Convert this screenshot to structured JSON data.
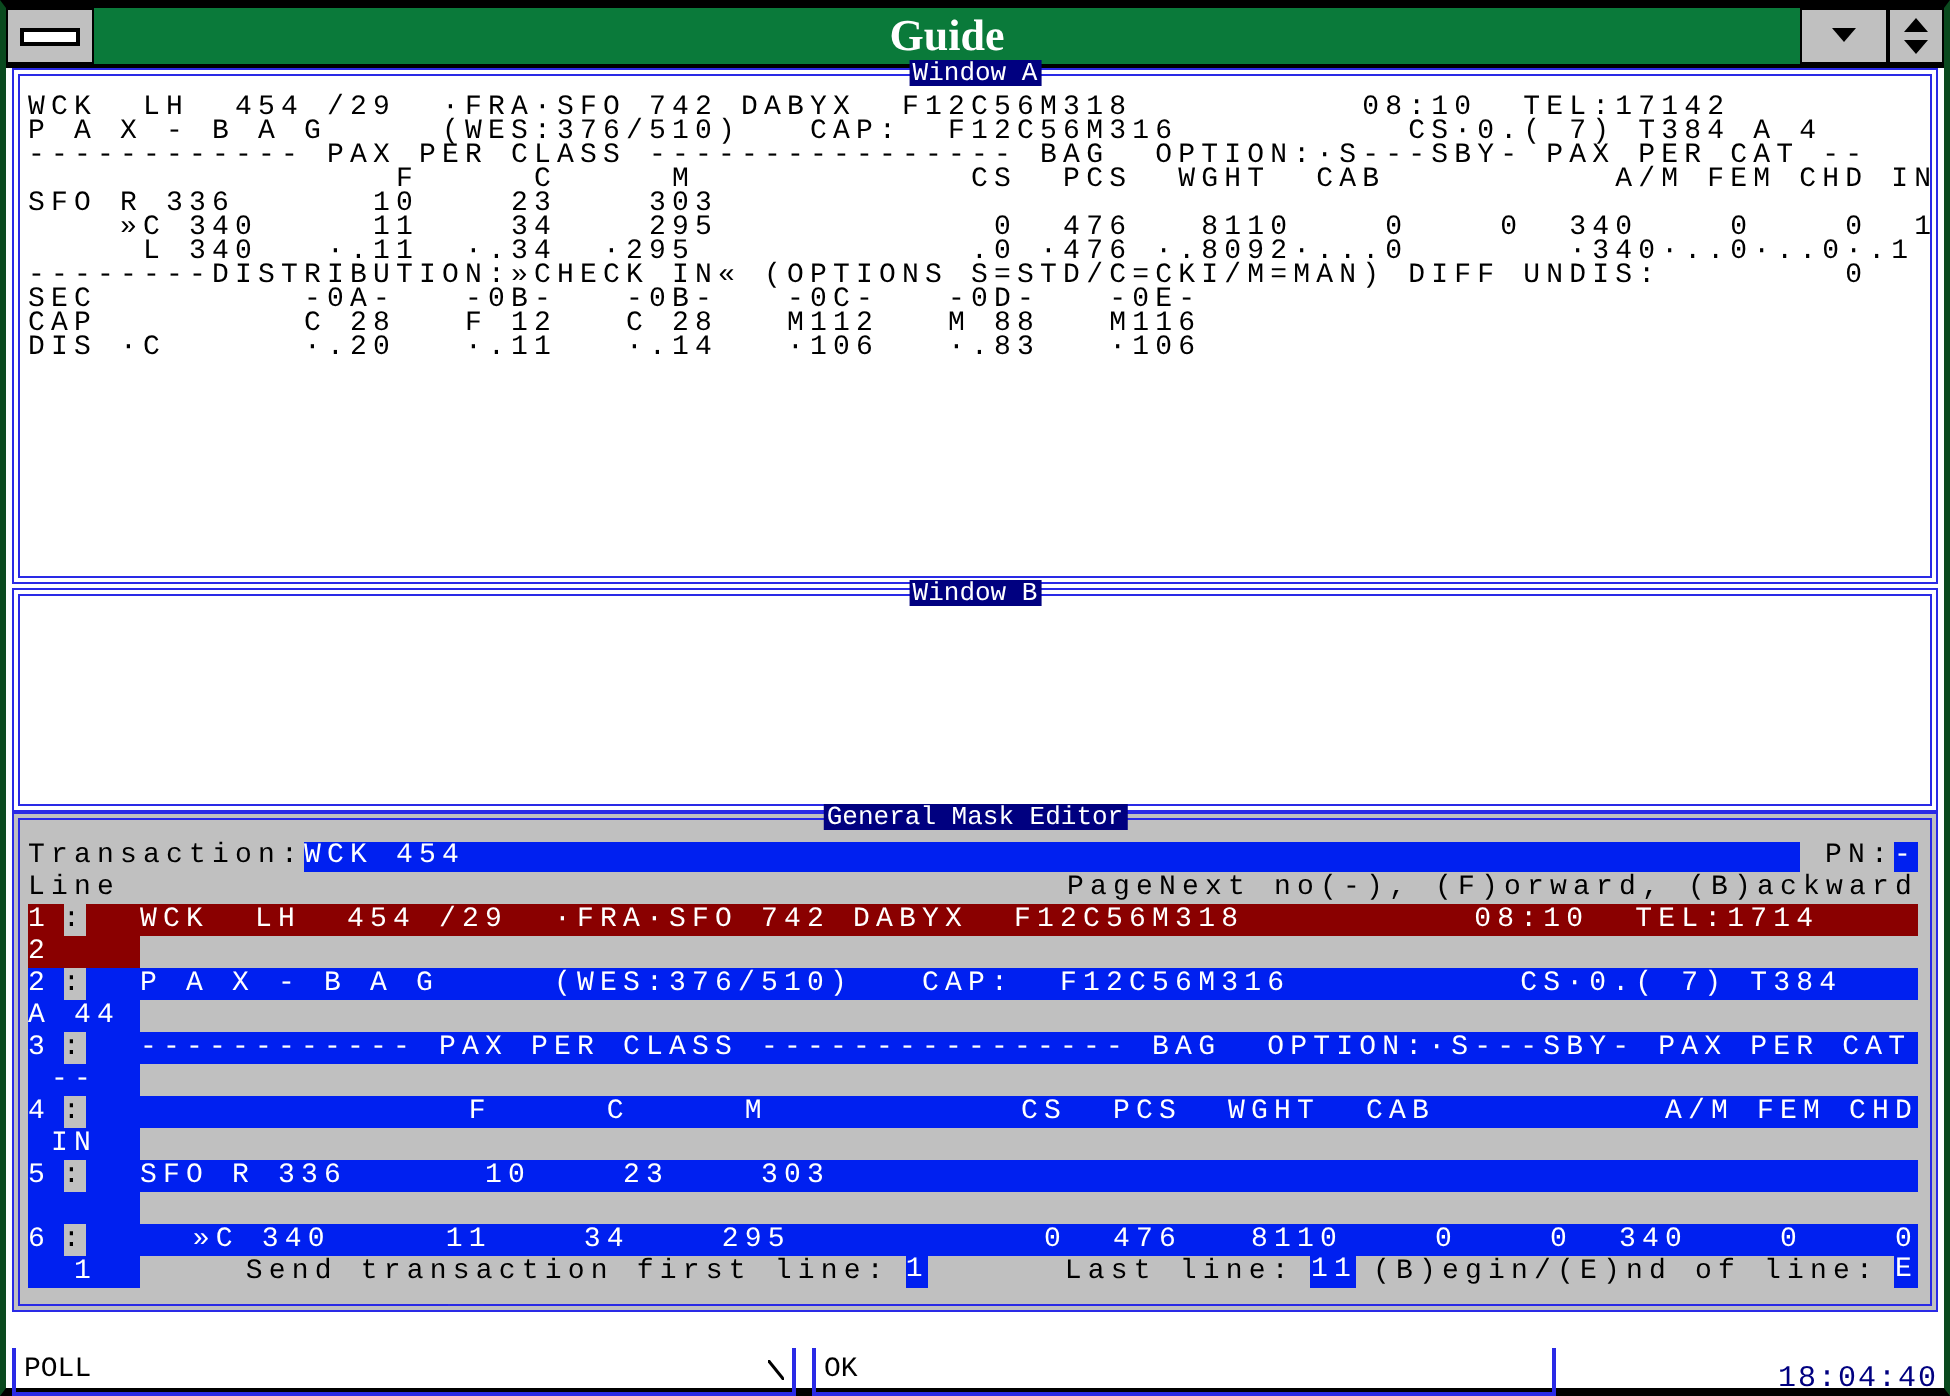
{
  "window": {
    "title": "Guide"
  },
  "window_a": {
    "title": "Window A",
    "lines": [
      "WCK  LH  454 /29  ·FRA·SFO 742 DABYX  F12C56M318          08:10  TEL:17142",
      "P A X - B A G     (WES:376/510)   CAP:  F12C56M316          CS·0.( 7) T384 A 4",
      "------------ PAX PER CLASS ---------------- BAG  OPTION:·S---SBY- PAX PER CAT --",
      "                F     C     M            CS  PCS  WGHT  CAB          A/M FEM CHD IN",
      "SFO R 336      10    23    303",
      "    »C 340     11    34    295            0  476   8110    0    0  340    0    0  1",
      "     L 340   ·.11  ·.34  ·295            .0 ·476 ·.8092·...0       ·340·..0·..0·.1",
      "--------DISTRIBUTION:»CHECK IN« (OPTIONS S=STD/C=CKI/M=MAN) DIFF UNDIS:        0",
      "SEC         -0A-   -0B-   -0B-   -0C-   -0D-   -0E-",
      "CAP         C 28   F 12   C 28   M112   M 88   M116",
      "DIS ·C      ·.20   ·.11   ·.14   ·106   ·.83   ·106"
    ]
  },
  "window_b": {
    "title": "Window B"
  },
  "mask_editor": {
    "title": "General Mask Editor",
    "transaction_label": "Transaction:",
    "transaction_value": "WCK 454",
    "pn_label": "PN:",
    "pn_value": "-",
    "line_label": "Line",
    "paging_hint": "PageNext no(-), (F)orward, (B)ackward",
    "rows": [
      {
        "number": "1",
        "marker": ":",
        "text": "WCK  LH  454 /29  ·FRA·SFO 742 DABYX  F12C56M318          08:10  TEL:1714",
        "continuation": "2",
        "selected": true
      },
      {
        "number": "2",
        "marker": ":",
        "text": "P A X - B A G     (WES:376/510)   CAP:  F12C56M316          CS·0.( 7) T384",
        "continuation": "A 44",
        "selected": false
      },
      {
        "number": "3",
        "marker": ":",
        "text": "------------ PAX PER CLASS ---------------- BAG  OPTION:·S---SBY- PAX PER CAT",
        "continuation": " --",
        "selected": false
      },
      {
        "number": "4",
        "marker": ":",
        "text": "                F     C     M           CS  PCS  WGHT  CAB          A/M FEM CHD",
        "continuation": " IN",
        "selected": false
      },
      {
        "number": "5",
        "marker": ":",
        "text": "SFO R 336      10    23    303",
        "selected": false
      },
      {
        "number": "6",
        "marker": ":",
        "text": "    »C 340     11    34    295           0  476   8110    0    0  340    0    0",
        "continuation": "  1",
        "selected": false
      }
    ],
    "footer": {
      "first_line_label": "Send transaction first line:",
      "first_line_value": "1",
      "last_line_label": "Last line:",
      "last_line_value": "11",
      "begin_end_label": "(B)egin/(E)nd of line:",
      "begin_end_value": "E"
    }
  },
  "status_bar": {
    "command": "POLL",
    "response": "OK",
    "time": "18:04:40"
  }
}
